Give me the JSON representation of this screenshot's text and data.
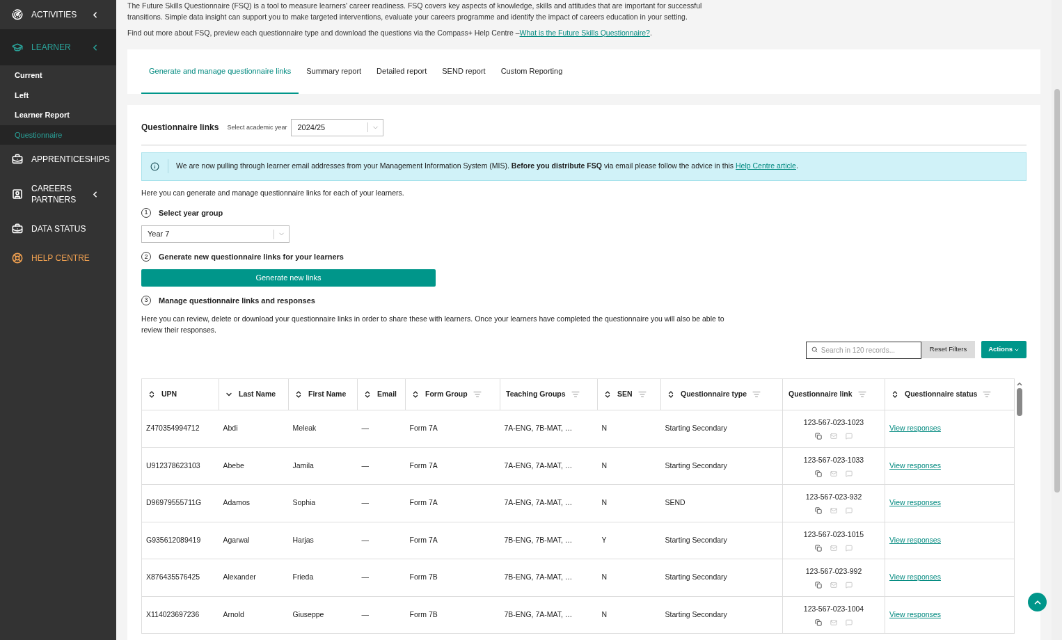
{
  "sidebar": {
    "items": [
      {
        "label": "ACTIVITIES",
        "kind": "activities",
        "has_submenu": true,
        "selected": false
      },
      {
        "label": "LEARNER",
        "kind": "learner",
        "has_submenu": true,
        "selected": true,
        "children": [
          {
            "label": "Current",
            "selected": false
          },
          {
            "label": "Left",
            "selected": false
          },
          {
            "label": "Learner Report",
            "selected": false
          },
          {
            "label": "Questionnaire",
            "selected": true
          }
        ]
      },
      {
        "label": "APPRENTICESHIPS",
        "kind": "briefcase",
        "has_submenu": false,
        "selected": false
      },
      {
        "label": "CAREERS PARTNERS",
        "kind": "contact",
        "has_submenu": true,
        "selected": false
      },
      {
        "label": "DATA STATUS",
        "kind": "briefcase",
        "has_submenu": false,
        "selected": false
      },
      {
        "label": "HELP CENTRE",
        "kind": "help",
        "has_submenu": false,
        "selected": false
      }
    ]
  },
  "intro": {
    "line_1": "The Future Skills Questionnaire (FSQ) is a tool to measure learners' career readiness. FSQ covers key aspects of knowledge, skills and attitudes that are important for successful",
    "line_2": "transitions. Simple data insight can support you to make targeted interventions, evaluate your careers programme and identify the impact of careers education in your setting.",
    "more": "Find out more about FSQ, preview each questionnaire type and download the questions via the Compass+ Help Centre –",
    "more_link": "What is the Future Skills Questionnaire?",
    "more_end": "."
  },
  "tabs": [
    {
      "label": "Generate and manage questionnaire links",
      "selected": true
    },
    {
      "label": "Summary report",
      "selected": false
    },
    {
      "label": "Detailed report",
      "selected": false
    },
    {
      "label": "SEND report",
      "selected": false
    },
    {
      "label": "Custom Reporting",
      "selected": false
    }
  ],
  "panel": {
    "title": "Questionnaire links",
    "year_label": "Select academic year",
    "year_value": "2024/25",
    "alert": {
      "text": "We are now pulling through learner email addresses from your Management Information System (MIS). **Before you distribute FSQ** via email please follow the advice in this",
      "link": "Help Centre article",
      "end": "."
    },
    "intro": "Here you can generate and manage questionnaire links for each of your learners.",
    "steps": [
      {
        "number": "1",
        "title": "Select year group"
      },
      {
        "number": "2",
        "title": "Generate new questionnaire links for your learners"
      },
      {
        "number": "3",
        "title": "Manage questionnaire links and responses"
      }
    ],
    "year_group": "Year 7",
    "generate_button": "Generate new links",
    "manage_text": "Here you can review, delete or download your questionnaire links in order to share these with learners. Once your learners have completed the questionnaire you will also be able to review their responses.",
    "search_placeholder": "Search in 120 records...",
    "reset_button": "Reset Filters",
    "actions_button": "Actions"
  },
  "table": {
    "columns": [
      {
        "label": "UPN",
        "sortable": true,
        "sorted": false,
        "filter": false
      },
      {
        "label": "Last Name",
        "sortable": true,
        "sorted": true,
        "filter": false
      },
      {
        "label": "First Name",
        "sortable": true,
        "sorted": false,
        "filter": false
      },
      {
        "label": "Email",
        "sortable": true,
        "sorted": false,
        "filter": false
      },
      {
        "label": "Form Group",
        "sortable": true,
        "sorted": false,
        "filter": true
      },
      {
        "label": "Teaching Groups",
        "sortable": false,
        "filter": true
      },
      {
        "label": "SEN",
        "sortable": true,
        "sorted": false,
        "filter": true
      },
      {
        "label": "Questionnaire type",
        "sortable": true,
        "sorted": false,
        "filter": true
      },
      {
        "label": "Questionnaire link",
        "sortable": false,
        "filter": true
      },
      {
        "label": "Questionnaire status",
        "sortable": true,
        "sorted": false,
        "filter": true
      }
    ],
    "rows": [
      {
        "upn": "Z470354994712",
        "last": "Abdi",
        "first": "Meleak",
        "email": "—",
        "form": "Form 7A",
        "teaching": "7A-ENG, 7B-MAT, …",
        "sen": "N",
        "type": "Starting Secondary",
        "link": "123-567-023-1023",
        "status": "View responses"
      },
      {
        "upn": "U912378623103",
        "last": "Abebe",
        "first": "Jamila",
        "email": "—",
        "form": "Form 7A",
        "teaching": "7A-ENG, 7A-MAT, …",
        "sen": "N",
        "type": "Starting Secondary",
        "link": "123-567-023-1033",
        "status": "View responses"
      },
      {
        "upn": "D96979555711G",
        "last": "Adamos",
        "first": "Sophia",
        "email": "—",
        "form": "Form 7A",
        "teaching": "7A-ENG, 7A-MAT, …",
        "sen": "N",
        "type": "SEND",
        "link": "123-567-023-932",
        "status": "View responses"
      },
      {
        "upn": "G935612089419",
        "last": "Agarwal",
        "first": "Harjas",
        "email": "—",
        "form": "Form 7A",
        "teaching": "7B-ENG, 7B-MAT, …",
        "sen": "Y",
        "type": "Starting Secondary",
        "link": "123-567-023-1015",
        "status": "View responses"
      },
      {
        "upn": "X876435576425",
        "last": "Alexander",
        "first": "Frieda",
        "email": "—",
        "form": "Form 7B",
        "teaching": "7B-ENG, 7A-MAT, …",
        "sen": "N",
        "type": "Starting Secondary",
        "link": "123-567-023-992",
        "status": "View responses"
      },
      {
        "upn": "X114023697236",
        "last": "Arnold",
        "first": "Giuseppe",
        "email": "—",
        "form": "Form 7B",
        "teaching": "7B-ENG, 7A-MAT, …",
        "sen": "N",
        "type": "Starting Secondary",
        "link": "123-567-023-1004",
        "status": "View responses"
      }
    ]
  }
}
